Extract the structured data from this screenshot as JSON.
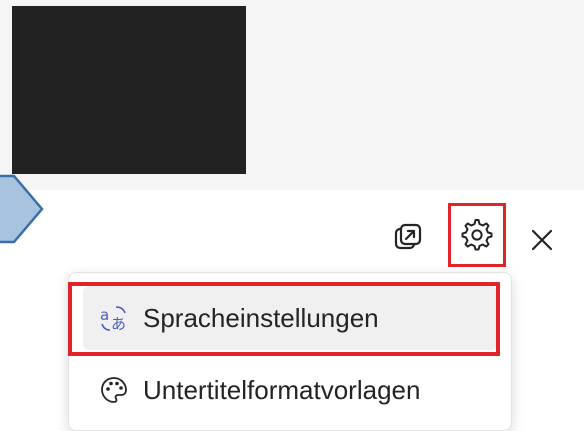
{
  "video": {
    "thumbnail": "video-thumbnail"
  },
  "toolbar": {
    "popout_icon": "popout-icon",
    "settings_icon": "gear-icon",
    "close_icon": "close-icon"
  },
  "settings_menu": {
    "items": [
      {
        "label": "Spracheinstellungen",
        "icon": "language-translate-icon"
      },
      {
        "label": "Untertitelformatvorlagen",
        "icon": "palette-icon"
      }
    ]
  },
  "colors": {
    "highlight": "#e0242a",
    "arrow_fill": "#a8c3e0",
    "arrow_stroke": "#3a6ea5",
    "icon_accent": "#4a5fc1"
  }
}
